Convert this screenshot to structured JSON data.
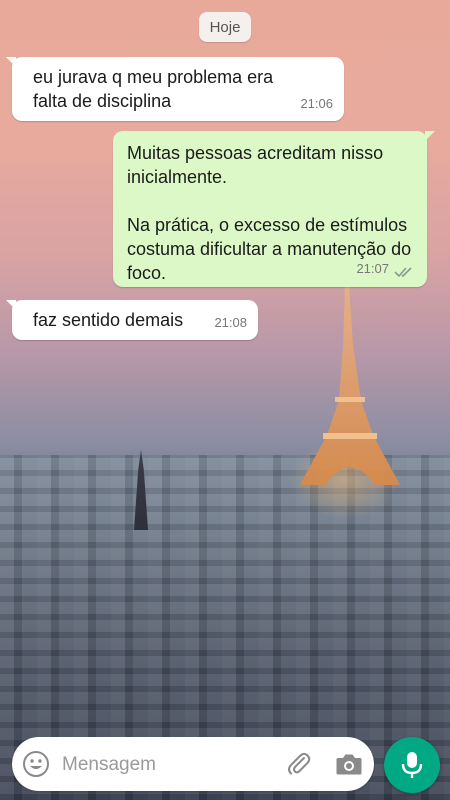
{
  "chat": {
    "date_chip": "Hoje",
    "messages": [
      {
        "direction": "incoming",
        "text": "eu jurava q meu problema era\nfalta de disciplina",
        "time": "21:06"
      },
      {
        "direction": "outgoing",
        "text": "Muitas pessoas acreditam nisso\ninicialmente.\n\nNa prática, o excesso de estímulos\ncostuma dificultar a manutenção do\nfoco.",
        "time": "21:07",
        "status": "read-double-check-icon"
      },
      {
        "direction": "incoming",
        "text": "faz sentido demais",
        "time": "21:08"
      }
    ]
  },
  "composer": {
    "placeholder": "Mensagem",
    "icons": [
      "emoji-icon",
      "paperclip-icon",
      "camera-icon",
      "microphone-icon"
    ]
  },
  "colors": {
    "outgoing_bubble": "#dcf8c6",
    "incoming_bubble": "#ffffff",
    "accent": "#00a884",
    "read_ticks": "#8a9a8c"
  }
}
